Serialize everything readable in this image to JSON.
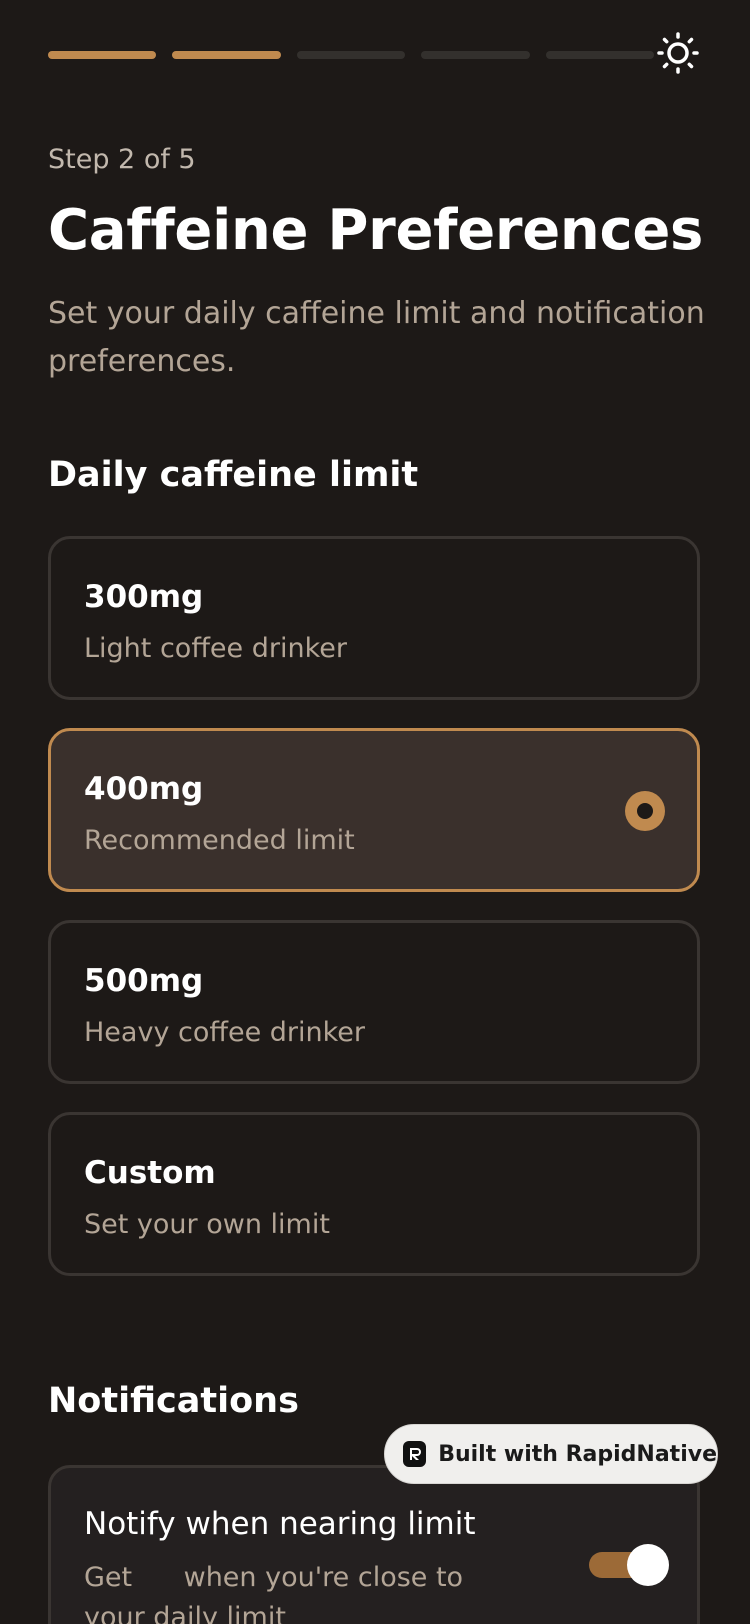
{
  "progress": {
    "total_steps": 5,
    "completed_steps": 2
  },
  "header": {
    "step_label": "Step 2 of 5",
    "title": "Caffeine Preferences",
    "subtitle": "Set your daily caffeine limit and notification preferences."
  },
  "limit_section": {
    "heading": "Daily caffeine limit",
    "options": [
      {
        "title": "300mg",
        "description": "Light coffee drinker",
        "selected": false
      },
      {
        "title": "400mg",
        "description": "Recommended limit",
        "selected": true
      },
      {
        "title": "500mg",
        "description": "Heavy coffee drinker",
        "selected": false
      },
      {
        "title": "Custom",
        "description": "Set your own limit",
        "selected": false
      }
    ]
  },
  "notifications": {
    "heading": "Notifications",
    "item": {
      "title": "Notify when nearing limit",
      "description": "Get      when you're close to your daily limit",
      "enabled": true
    }
  },
  "badge": {
    "text": "Built with RapidNative"
  },
  "icons": {
    "theme": "sun-icon",
    "selected": "radio-selected-icon",
    "badge_logo": "rapidnative-logo-icon"
  },
  "colors": {
    "background": "#1d1917",
    "accent": "#c08a4f",
    "selected_card": "#3a302c",
    "muted_text": "#b3a596",
    "toggle_on": "#9c6a37"
  }
}
